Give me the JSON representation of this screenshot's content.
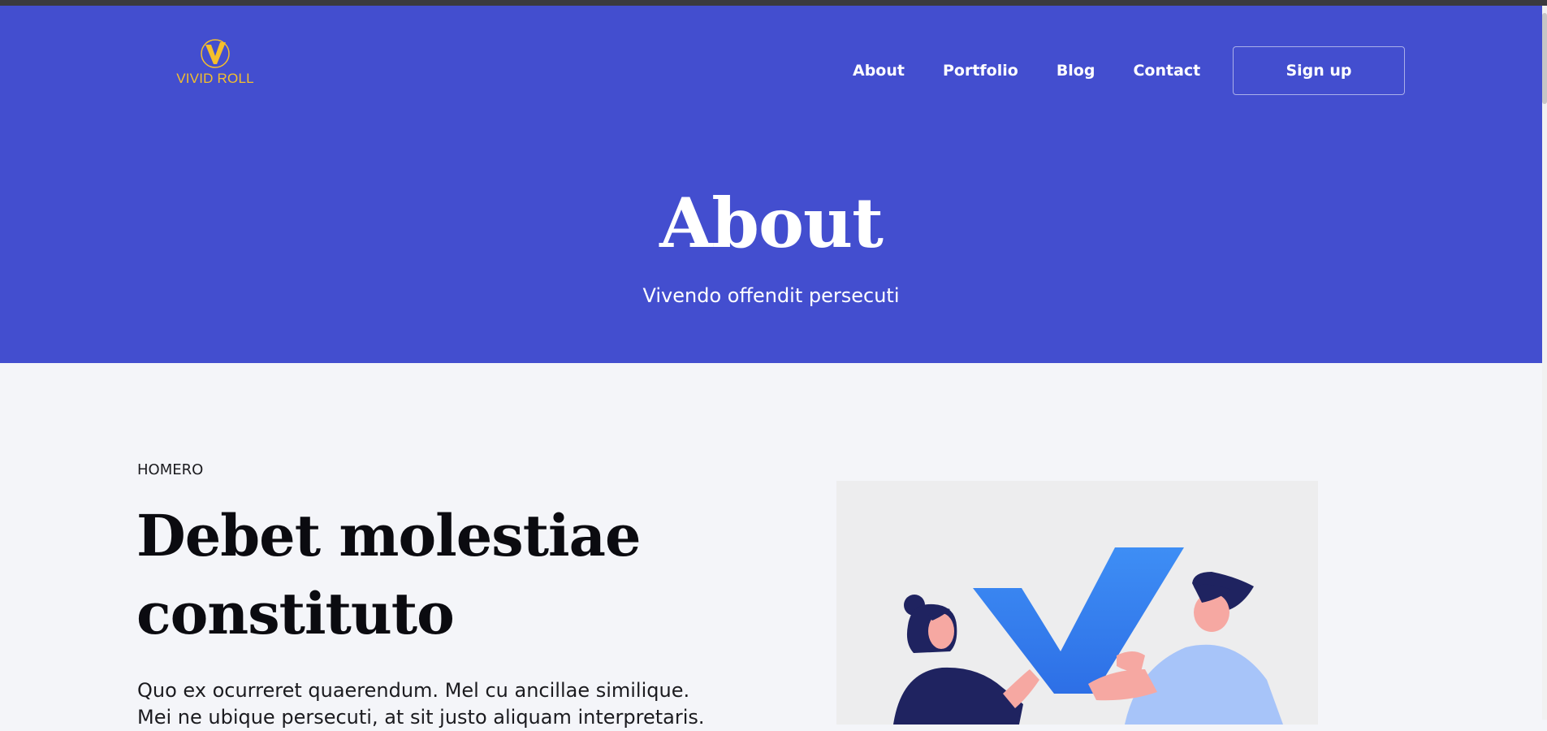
{
  "brand": {
    "logo_text": "VIVID ROLL",
    "logo_color": "#f5bf2b",
    "primary_color": "#434ecf"
  },
  "nav": {
    "items": [
      {
        "label": "About"
      },
      {
        "label": "Portfolio"
      },
      {
        "label": "Blog"
      },
      {
        "label": "Contact"
      }
    ],
    "cta_label": "Sign up"
  },
  "hero": {
    "title": "About",
    "subtitle": "Vivendo offendit persecuti"
  },
  "section": {
    "eyebrow": "HOMERO",
    "title": "Debet molestiae constituto",
    "body": "Quo ex ocurreret quaerendum. Mel cu ancillae similique. Mei ne ubique persecuti, at sit justo aliquam interpretaris."
  }
}
